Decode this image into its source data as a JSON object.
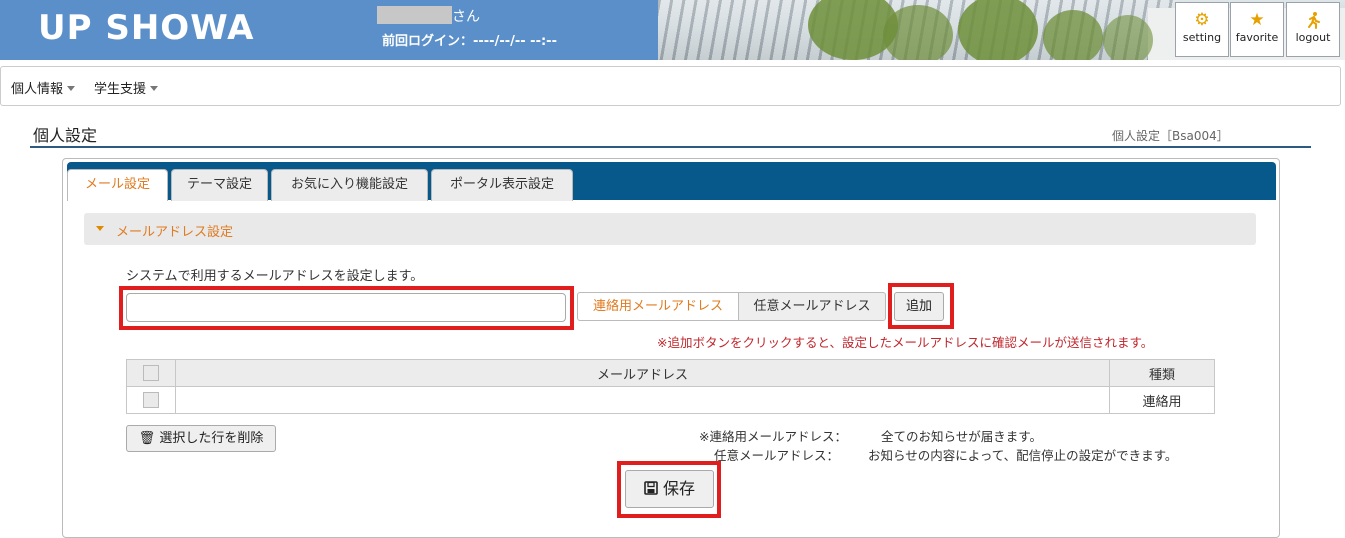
{
  "header": {
    "logo": "UP SHOWA",
    "user_suffix": "さん",
    "last_login": "前回ログイン：----/--/-- --:--",
    "buttons": [
      {
        "label": "setting",
        "icon": "gear-icon"
      },
      {
        "label": "favorite",
        "icon": "star-icon"
      },
      {
        "label": "logout",
        "icon": "running-person-icon"
      }
    ]
  },
  "nav": {
    "items": [
      "個人情報",
      "学生支援"
    ]
  },
  "page": {
    "title": "個人設定",
    "code": "個人設定［Bsa004］"
  },
  "tabs": [
    "メール設定",
    "テーマ設定",
    "お気に入り機能設定",
    "ポータル表示設定"
  ],
  "section": {
    "title": "メールアドレス設定",
    "description": "システムで利用するメールアドレスを設定します。",
    "input_value": "",
    "type_primary": "連絡用メールアドレス",
    "type_optional": "任意メールアドレス",
    "add_button": "追加",
    "add_note": "※追加ボタンをクリックすると、設定したメールアドレスに確認メールが送信されます。"
  },
  "table": {
    "headers": [
      "",
      "メールアドレス",
      "種類"
    ],
    "rows": [
      {
        "email": "",
        "type": "連絡用"
      }
    ]
  },
  "delete_button": "選択した行を削除",
  "legend": {
    "primary_label": "※連絡用メールアドレス：",
    "primary_text": "全てのお知らせが届きます。",
    "optional_label": "任意メールアドレス：",
    "optional_text": "お知らせの内容によって、配信停止の設定ができます。"
  },
  "save_button": "保存",
  "colors": {
    "header_bg": "#5b8fc9",
    "tabbar_bg": "#06598a",
    "accent": "#e07b20",
    "highlight": "#e01e1e",
    "note_red": "#c0272d"
  }
}
